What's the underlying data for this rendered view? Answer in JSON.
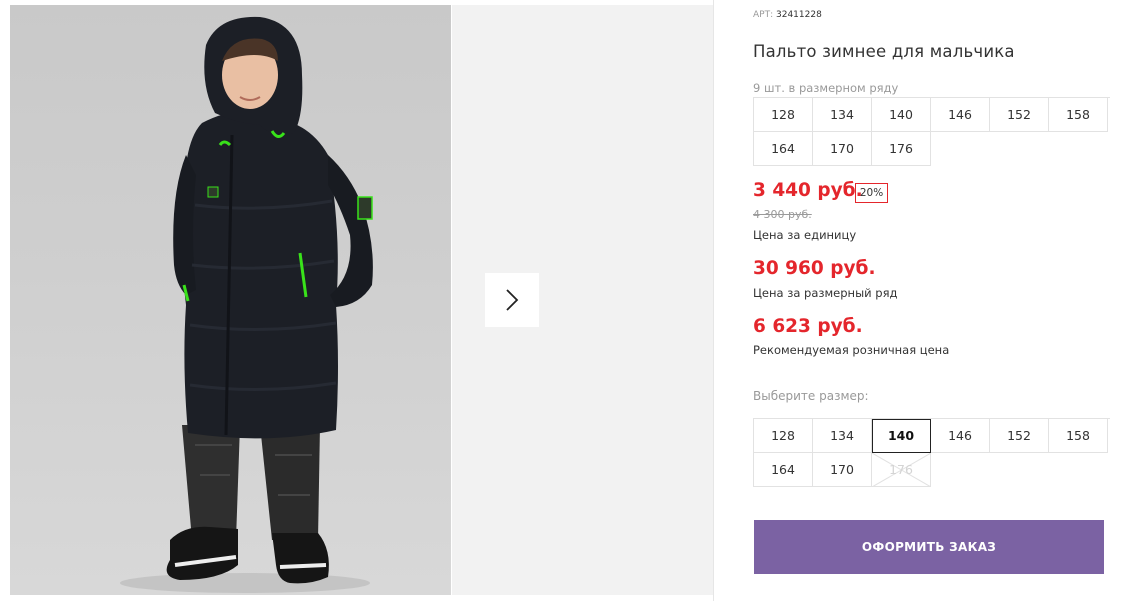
{
  "product": {
    "article_label": "АРТ:",
    "article_value": "32411228",
    "title": "Пальто зимнее для мальчика",
    "row_count_text": "9 шт. в размерном ряду"
  },
  "size_row": {
    "sizes": [
      "128",
      "134",
      "140",
      "146",
      "152",
      "158",
      "164",
      "170",
      "176"
    ]
  },
  "prices": {
    "current": "3 440 руб.",
    "discount": "20%",
    "old": "4 300 руб.",
    "unit_caption": "Цена за единицу",
    "row_price": "30 960 руб.",
    "row_caption": "Цена за размерный ряд",
    "retail_price": "6 623 руб.",
    "retail_caption": "Рекомендуемая розничная цена"
  },
  "size_selector": {
    "label": "Выберите размер:",
    "sizes": [
      "128",
      "134",
      "140",
      "146",
      "152",
      "158",
      "164",
      "170",
      "176"
    ],
    "selected": "140",
    "disabled": [
      "176"
    ]
  },
  "order_button": {
    "label": "ОФОРМИТЬ ЗАКАЗ"
  },
  "gallery": {
    "next_icon": "chevron-right-icon"
  },
  "colors": {
    "price_red": "#e4262c",
    "order_button": "#7b62a3",
    "jacket_accent": "#39e21a"
  }
}
